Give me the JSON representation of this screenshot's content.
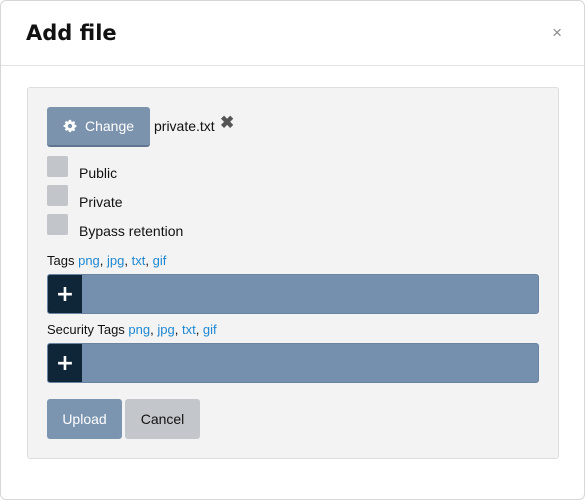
{
  "dialog": {
    "title": "Add file",
    "close_glyph": "×"
  },
  "file": {
    "change_label": "Change",
    "change_icon": "gear-icon",
    "name": "private.txt",
    "remove_glyph": "✖"
  },
  "options": [
    {
      "label": "Public",
      "checked": false
    },
    {
      "label": "Private",
      "checked": false
    },
    {
      "label": "Bypass retention",
      "checked": false
    }
  ],
  "tags": {
    "label": "Tags",
    "extensions": [
      "png",
      "jpg",
      "txt",
      "gif"
    ],
    "add_glyph": "+"
  },
  "security_tags": {
    "label": "Security Tags",
    "extensions": [
      "png",
      "jpg",
      "txt",
      "gif"
    ],
    "add_glyph": "+"
  },
  "actions": {
    "upload_label": "Upload",
    "cancel_label": "Cancel"
  },
  "colors": {
    "primary_button": "#7b94b0",
    "secondary_button": "#c3c6ca",
    "tag_bar": "#7590ae",
    "tag_add": "#0f2538",
    "link": "#1e88d2"
  }
}
